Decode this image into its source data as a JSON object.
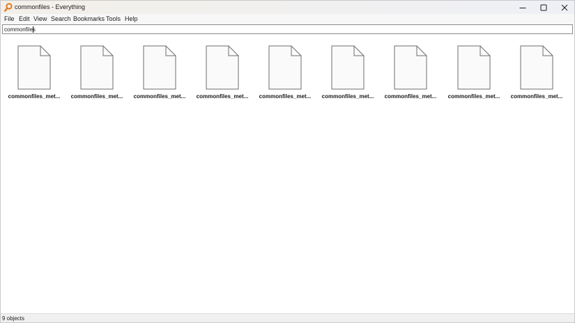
{
  "window": {
    "title": "commonfiles - Everything",
    "icon": "magnifier-app-icon",
    "controls": [
      "minimize-icon",
      "maximize-icon",
      "close-icon"
    ]
  },
  "menu": {
    "items": [
      "File",
      "Edit",
      "View",
      "Search",
      "Bookmarks",
      "Tools",
      "Help"
    ]
  },
  "search": {
    "value": "commonfiles"
  },
  "results": {
    "items": [
      {
        "name": "commonfiles_met...",
        "icon": "document-icon"
      },
      {
        "name": "commonfiles_met...",
        "icon": "document-icon"
      },
      {
        "name": "commonfiles_met...",
        "icon": "document-icon"
      },
      {
        "name": "commonfiles_met...",
        "icon": "document-icon"
      },
      {
        "name": "commonfiles_met...",
        "icon": "document-icon"
      },
      {
        "name": "commonfiles_met...",
        "icon": "document-icon"
      },
      {
        "name": "commonfiles_met...",
        "icon": "document-icon"
      },
      {
        "name": "commonfiles_met...",
        "icon": "document-icon"
      },
      {
        "name": "commonfiles_met...",
        "icon": "document-icon"
      }
    ]
  },
  "status": {
    "text": "9 objects"
  },
  "colors": {
    "app_icon": "#e07a1f",
    "file_fill": "#fafafa",
    "file_stroke": "#6e6e6e"
  }
}
